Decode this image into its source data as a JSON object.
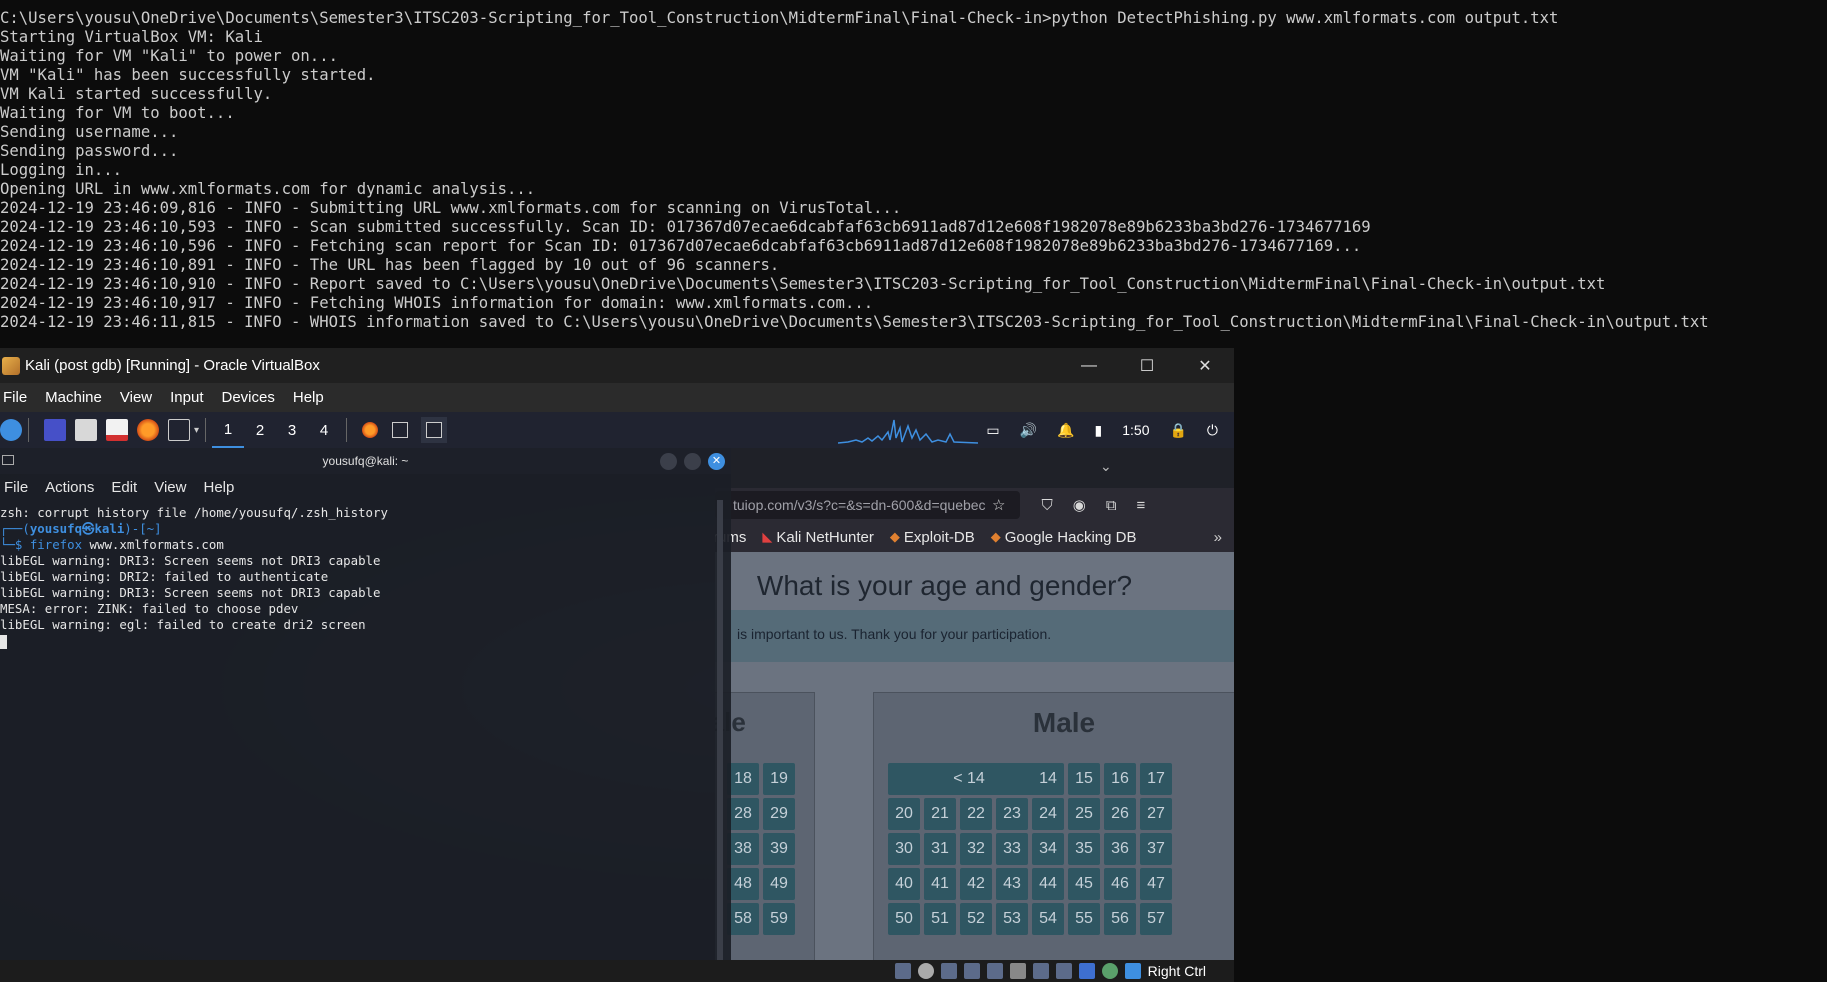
{
  "host_terminal": {
    "lines": [
      "C:\\Users\\yousu\\OneDrive\\Documents\\Semester3\\ITSC203-Scripting_for_Tool_Construction\\MidtermFinal\\Final-Check-in>python DetectPhishing.py www.xmlformats.com output.txt",
      "Starting VirtualBox VM: Kali",
      "Waiting for VM \"Kali\" to power on...",
      "VM \"Kali\" has been successfully started.",
      "VM Kali started successfully.",
      "Waiting for VM to boot...",
      "Sending username...",
      "Sending password...",
      "Logging in...",
      "Opening URL in www.xmlformats.com for dynamic analysis...",
      "2024-12-19 23:46:09,816 - INFO - Submitting URL www.xmlformats.com for scanning on VirusTotal...",
      "2024-12-19 23:46:10,593 - INFO - Scan submitted successfully. Scan ID: 017367d07ecae6dcabfaf63cb6911ad87d12e608f1982078e89b6233ba3bd276-1734677169",
      "2024-12-19 23:46:10,596 - INFO - Fetching scan report for Scan ID: 017367d07ecae6dcabfaf63cb6911ad87d12e608f1982078e89b6233ba3bd276-1734677169...",
      "2024-12-19 23:46:10,891 - INFO - The URL has been flagged by 10 out of 96 scanners.",
      "2024-12-19 23:46:10,910 - INFO - Report saved to C:\\Users\\yousu\\OneDrive\\Documents\\Semester3\\ITSC203-Scripting_for_Tool_Construction\\MidtermFinal\\Final-Check-in\\output.txt",
      "2024-12-19 23:46:10,917 - INFO - Fetching WHOIS information for domain: www.xmlformats.com...",
      "2024-12-19 23:46:11,815 - INFO - WHOIS information saved to C:\\Users\\yousu\\OneDrive\\Documents\\Semester3\\ITSC203-Scripting_for_Tool_Construction\\MidtermFinal\\Final-Check-in\\output.txt"
    ]
  },
  "vbox": {
    "title": "Kali (post gdb) [Running] - Oracle VirtualBox",
    "minimize_glyph": "—",
    "maximize_glyph": "☐",
    "close_glyph": "✕",
    "menu": [
      "File",
      "Machine",
      "View",
      "Input",
      "Devices",
      "Help"
    ],
    "status_host_key": "Right Ctrl"
  },
  "kali_panel": {
    "workspaces": [
      "1",
      "2",
      "3",
      "4"
    ],
    "active_workspace": "1",
    "clock": "1:50",
    "cpu_graph_color": "#3e8fe0"
  },
  "kali_terminal": {
    "title": "yousufq@kali: ~",
    "menu": [
      "File",
      "Actions",
      "Edit",
      "View",
      "Help"
    ],
    "line1": "zsh: corrupt history file /home/yousufq/.zsh_history",
    "prompt_open": "┌──(",
    "prompt_user": "yousufq㉿kali",
    "prompt_close": ")-[~]",
    "prompt_cmd_prefix": "└─$ ",
    "prompt_cmd": "firefox",
    "prompt_arg": " www.xmlformats.com",
    "warnings": [
      "libEGL warning: DRI3: Screen seems not DRI3 capable",
      "libEGL warning: DRI2: failed to authenticate",
      "libEGL warning: DRI3: Screen seems not DRI3 capable",
      "MESA: error: ZINK: failed to choose pdev",
      "libEGL warning: egl: failed to create dri2 screen"
    ]
  },
  "firefox": {
    "url": "tuiop.com/v3/s?c=&s=dn-600&d=quebec",
    "bookmarks": [
      "rums",
      "Kali NetHunter",
      "Exploit-DB",
      "Google Hacking DB"
    ],
    "question": "What is your age and gender?",
    "subtitle": "is important to us. Thank you for your participation.",
    "female_label": "Female",
    "male_label": "Male",
    "female_ages": [
      "18",
      "19",
      "28",
      "29",
      "38",
      "39",
      "48",
      "49",
      "58",
      "59"
    ],
    "male_ages": [
      "< 14",
      "14",
      "15",
      "16",
      "17",
      "20",
      "21",
      "22",
      "23",
      "24",
      "25",
      "26",
      "27",
      "30",
      "31",
      "32",
      "33",
      "34",
      "35",
      "36",
      "37",
      "40",
      "41",
      "42",
      "43",
      "44",
      "45",
      "46",
      "47",
      "50",
      "51",
      "52",
      "53",
      "54",
      "55",
      "56",
      "57"
    ]
  },
  "colors": {
    "accent": "#3e8fe0",
    "age_button": "#2f5662"
  }
}
